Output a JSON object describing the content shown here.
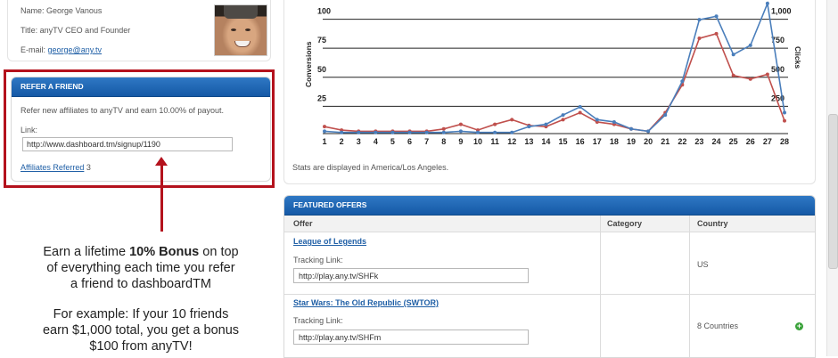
{
  "profile": {
    "name_label": "Name: George Vanous",
    "title_label": "Title: anyTV CEO and Founder",
    "email_prefix": "E-mail:",
    "email": "george@any.tv"
  },
  "refer": {
    "header": "REFER A FRIEND",
    "description": "Refer new affiliates to anyTV and earn 10.00% of payout.",
    "link_label": "Link:",
    "link_value": "http://www.dashboard.tm/signup/1190",
    "referred_label": "Affiliates Referred",
    "referred_count": "3"
  },
  "promo": {
    "line1": "Earn a lifetime",
    "bonus": "10% Bonus",
    "line1_end": "on top",
    "line2": "of everything each time you refer",
    "line3": "a friend to dashboardTM",
    "line4": "For example: If your 10 friends",
    "line5": "earn $1,000 total, you get a bonus",
    "line6": "$100 from anyTV!"
  },
  "chart_data": {
    "type": "line",
    "x": [
      1,
      2,
      3,
      4,
      5,
      6,
      7,
      8,
      9,
      10,
      11,
      12,
      13,
      14,
      15,
      16,
      17,
      18,
      19,
      20,
      21,
      22,
      23,
      24,
      25,
      26,
      27,
      28
    ],
    "ylabel_left": "Conversions",
    "ylabel_right": "Clicks",
    "left_ticks": [
      "25",
      "50",
      "75",
      "100"
    ],
    "right_ticks": [
      "250",
      "500",
      "750",
      "1,000"
    ],
    "grid": true,
    "series": [
      {
        "color": "#4a7ebb",
        "values": [
          2,
          1,
          1,
          1,
          1,
          1,
          1,
          1,
          2,
          1,
          1,
          1,
          6,
          8,
          16,
          23,
          12,
          10,
          4,
          2,
          16,
          45,
          98,
          101,
          68,
          76,
          112,
          18
        ]
      },
      {
        "color": "#c0504d",
        "values": [
          6,
          3,
          2,
          2,
          2,
          2,
          2,
          4,
          8,
          3,
          8,
          12,
          7,
          6,
          12,
          18,
          10,
          8,
          4,
          2,
          18,
          42,
          82,
          86,
          50,
          47,
          51,
          11
        ]
      }
    ],
    "note": "Stats are displayed in America/Los Angeles."
  },
  "offers": {
    "header": "FEATURED OFFERS",
    "columns": [
      "Offer",
      "Category",
      "Country"
    ],
    "rows": [
      {
        "name": "League of Legends",
        "tracking_label": "Tracking Link:",
        "tracking_url": "http://play.any.tv/SHFk",
        "category": "",
        "country": "US"
      },
      {
        "name": "Star Wars: The Old Republic (SWTOR)",
        "tracking_label": "Tracking Link:",
        "tracking_url": "http://play.any.tv/SHFm",
        "category": "",
        "country": "8 Countries"
      }
    ]
  }
}
